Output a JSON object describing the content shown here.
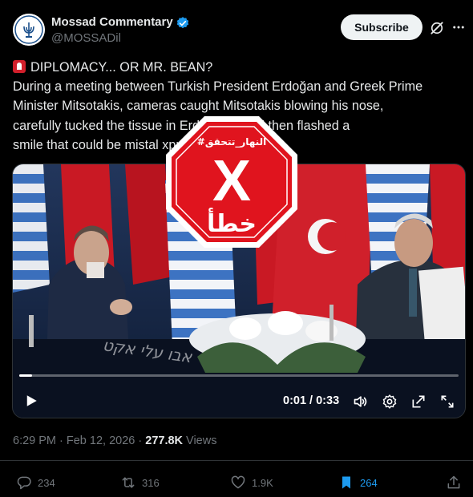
{
  "author": {
    "name": "Mossad Commentary",
    "handle": "@MOSSADil",
    "verified": true
  },
  "subscribe_label": "Subscribe",
  "tweet": {
    "lines": [
      "DIPLOMACY... OR MR. BEAN?",
      "During a meeting between Turkish President Erdoğan and Greek Prime",
      "Minister Mitsotakis, cameras caught Mitsotakis blowing his nose,",
      "carefully tucked the tissue in                         Erdoğan... and then flashed a",
      "smile that could be mistal                              xpression."
    ]
  },
  "video": {
    "watermark": "אבו עלי אקט",
    "time": "0:01 / 0:33",
    "progress": 0.03
  },
  "stamp": {
    "top_text": "#النهار_تتحقق",
    "mark": "X",
    "bottom_text": "خطأ",
    "color": "#e0141e"
  },
  "meta": {
    "time": "6:29 PM",
    "date": "Feb 12, 2026",
    "views_count": "277.8K",
    "views_label": "Views"
  },
  "actions": {
    "replies": "234",
    "reposts": "316",
    "likes": "1.9K",
    "bookmarks": "264"
  },
  "colors": {
    "background": "#000000",
    "accent": "#1d9bf0",
    "muted": "#71767b"
  }
}
